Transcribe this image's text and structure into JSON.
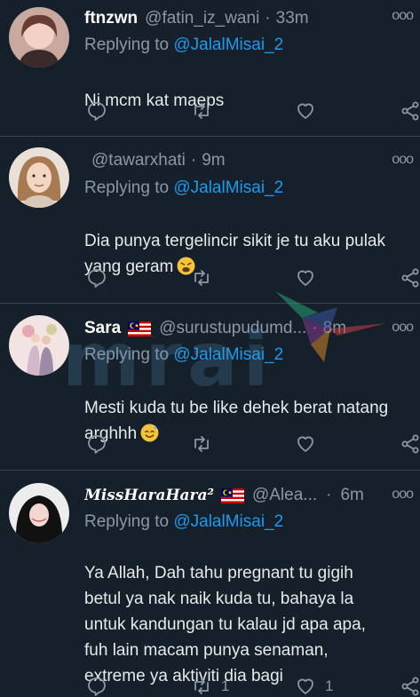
{
  "tweets": [
    {
      "name": "ftnzwn",
      "handle": "@fatin_iz_wani",
      "dot": "·",
      "time": "33m",
      "reply_prefix": "Replying to",
      "reply_mention": "@JalalMisai_2",
      "body": "Ni mcm kat maeps",
      "retweets": "",
      "likes": ""
    },
    {
      "name": "",
      "handle": "@tawarxhati",
      "dot": "·",
      "time": "9m",
      "reply_prefix": "Replying to",
      "reply_mention": "@JalalMisai_2",
      "body": "Dia punya tergelincir sikit je tu aku pulak\nyang geram",
      "emoji": "weary-face",
      "retweets": "",
      "likes": ""
    },
    {
      "name": "Sara",
      "flag": "malaysia-flag",
      "handle": "@surustupudumd...",
      "dot": "·",
      "time": "8m",
      "reply_prefix": "Replying to",
      "reply_mention": "@JalalMisai_2",
      "body": "Mesti kuda tu be like dehek berat natang\narghhh",
      "emoji": "sweat-smile-face",
      "retweets": "",
      "likes": ""
    },
    {
      "name": "MissHaraHara²",
      "flag": "malaysia-flag",
      "handle": "@Alea...",
      "dot": "·",
      "time": "6m",
      "reply_prefix": "Replying to",
      "reply_mention": "@JalalMisai_2",
      "body": "Ya Allah, Dah tahu pregnant tu gigih\nbetul ya nak naik kuda tu, bahaya la\nuntuk kandungan tu kalau jd apa apa,\nfuh lain macam punya senaman,\nextreme ya aktiviti dia bagi",
      "retweets": "1",
      "likes": "1"
    }
  ],
  "more_glyph": "ooo",
  "icons": [
    "reply-icon",
    "retweet-icon",
    "like-icon",
    "share-icon"
  ],
  "watermark": "mrai",
  "colors": {
    "background": "#15202b",
    "mention": "#1d9bf0",
    "muted": "#8b98a5",
    "divider": "#38444d"
  }
}
